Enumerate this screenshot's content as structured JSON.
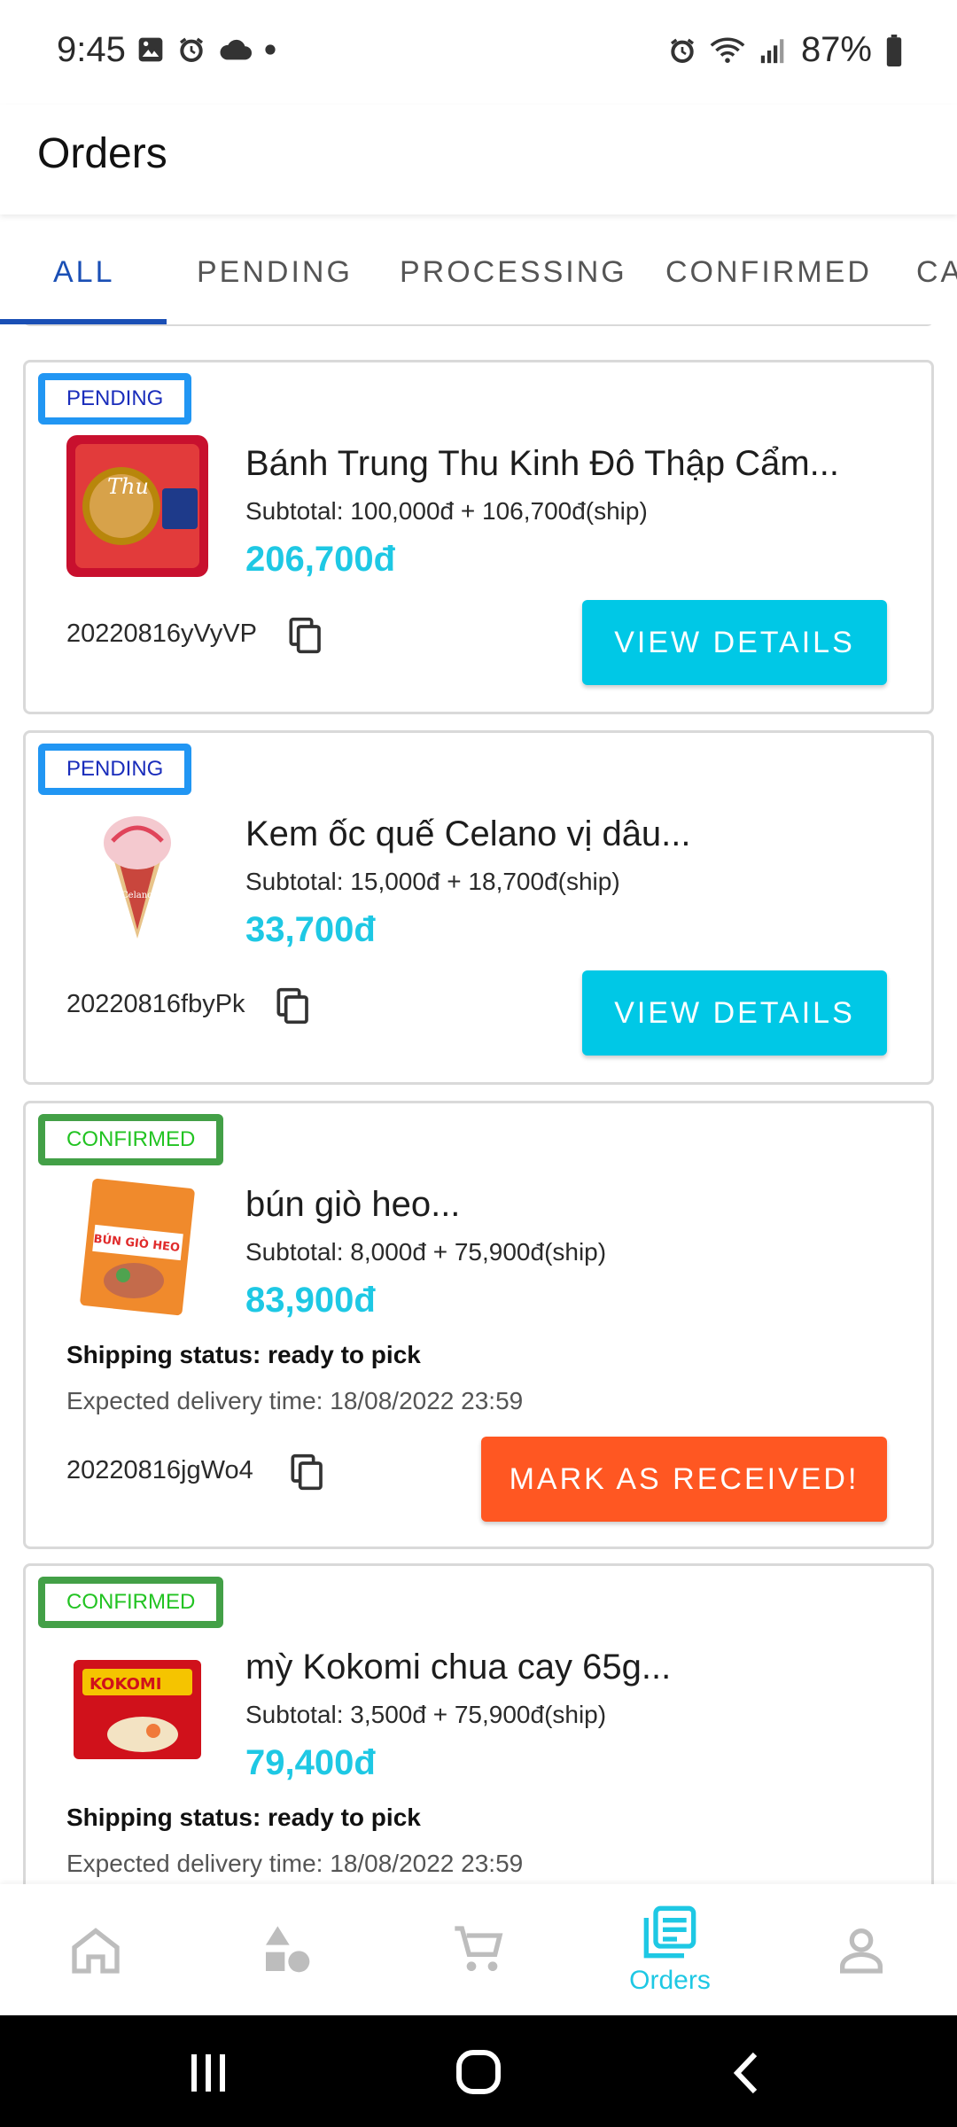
{
  "status_bar": {
    "time": "9:45",
    "battery": "87%"
  },
  "app_bar": {
    "title": "Orders"
  },
  "tabs": [
    {
      "label": "ALL",
      "active": true
    },
    {
      "label": "PENDING",
      "active": false
    },
    {
      "label": "PROCESSING",
      "active": false
    },
    {
      "label": "CONFIRMED",
      "active": false
    },
    {
      "label": "CA",
      "active": false
    }
  ],
  "orders": [
    {
      "status": "PENDING",
      "name": "Bánh Trung Thu Kinh Đô Thập Cẩm...",
      "subtotal": "Subtotal: 100,000đ + 106,700đ(ship)",
      "total": "206,700đ",
      "order_id": "20220816yVyVP",
      "action": "VIEW DETAILS",
      "thumb_text": "Thu"
    },
    {
      "status": "PENDING",
      "name": "Kem ốc quế Celano vị dâu...",
      "subtotal": "Subtotal: 15,000đ + 18,700đ(ship)",
      "total": "33,700đ",
      "order_id": "20220816fbyPk",
      "action": "VIEW DETAILS",
      "thumb_text": "Celano"
    },
    {
      "status": "CONFIRMED",
      "name": "bún giò heo...",
      "subtotal": "Subtotal: 8,000đ + 75,900đ(ship)",
      "total": "83,900đ",
      "shipping_status": "Shipping status: ready to pick",
      "expected": "Expected delivery time: 18/08/2022 23:59",
      "order_id": "20220816jgWo4",
      "action": "MARK AS RECEIVED!",
      "thumb_text": "BÚN GIÒ HEO"
    },
    {
      "status": "CONFIRMED",
      "name": "mỳ Kokomi chua cay 65g...",
      "subtotal": "Subtotal: 3,500đ + 75,900đ(ship)",
      "total": "79,400đ",
      "shipping_status": "Shipping status: ready to pick",
      "expected": "Expected delivery time: 18/08/2022 23:59",
      "thumb_text": "KOKOMI"
    }
  ],
  "bottom_nav": [
    {
      "icon": "home-icon",
      "label": ""
    },
    {
      "icon": "categories-icon",
      "label": ""
    },
    {
      "icon": "cart-icon",
      "label": ""
    },
    {
      "icon": "orders-icon",
      "label": "Orders",
      "active": true
    },
    {
      "icon": "account-icon",
      "label": ""
    }
  ],
  "colors": {
    "accent": "#1ec8e4",
    "tab_active": "#1a4fb5",
    "pending_border": "#2196f3",
    "confirmed_border": "#43a047",
    "received_button": "#ff5722"
  }
}
